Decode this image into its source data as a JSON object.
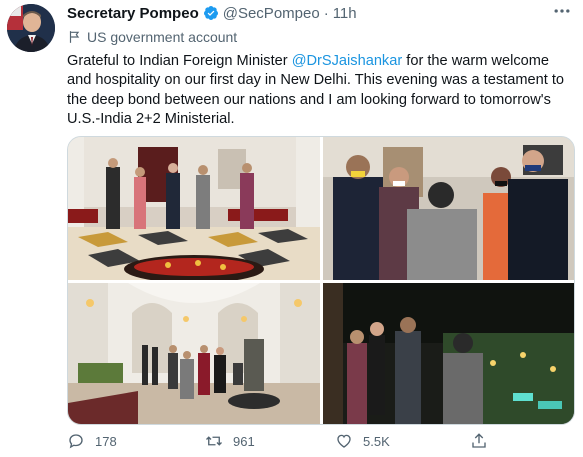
{
  "author": {
    "name": "Secretary Pompeo",
    "handle": "@SecPompeo",
    "separator": "·",
    "time": "11h",
    "label": "US government account"
  },
  "tweet": {
    "text_before": "Grateful to Indian Foreign Minister ",
    "mention": "@DrSJaishankar",
    "text_after": " for the warm welcome and hospitality on our first day in New Delhi. This evening was a testament to the deep bond between our nations and I am looking forward to tomorrow's U.S.-India 2+2 Ministerial."
  },
  "actions": {
    "replies": "178",
    "retweets": "961",
    "likes": "5.5K"
  },
  "icons": {
    "avatar": "avatar-portrait",
    "verified": "verified-badge-icon",
    "more": "more-dots-icon",
    "gov": "flag-icon",
    "reply": "reply-icon",
    "retweet": "retweet-icon",
    "like": "heart-icon",
    "share": "share-icon"
  },
  "colors": {
    "link": "#1b95e0",
    "muted": "#536471",
    "verified": "#1d9bf0",
    "text": "#0f1419"
  }
}
